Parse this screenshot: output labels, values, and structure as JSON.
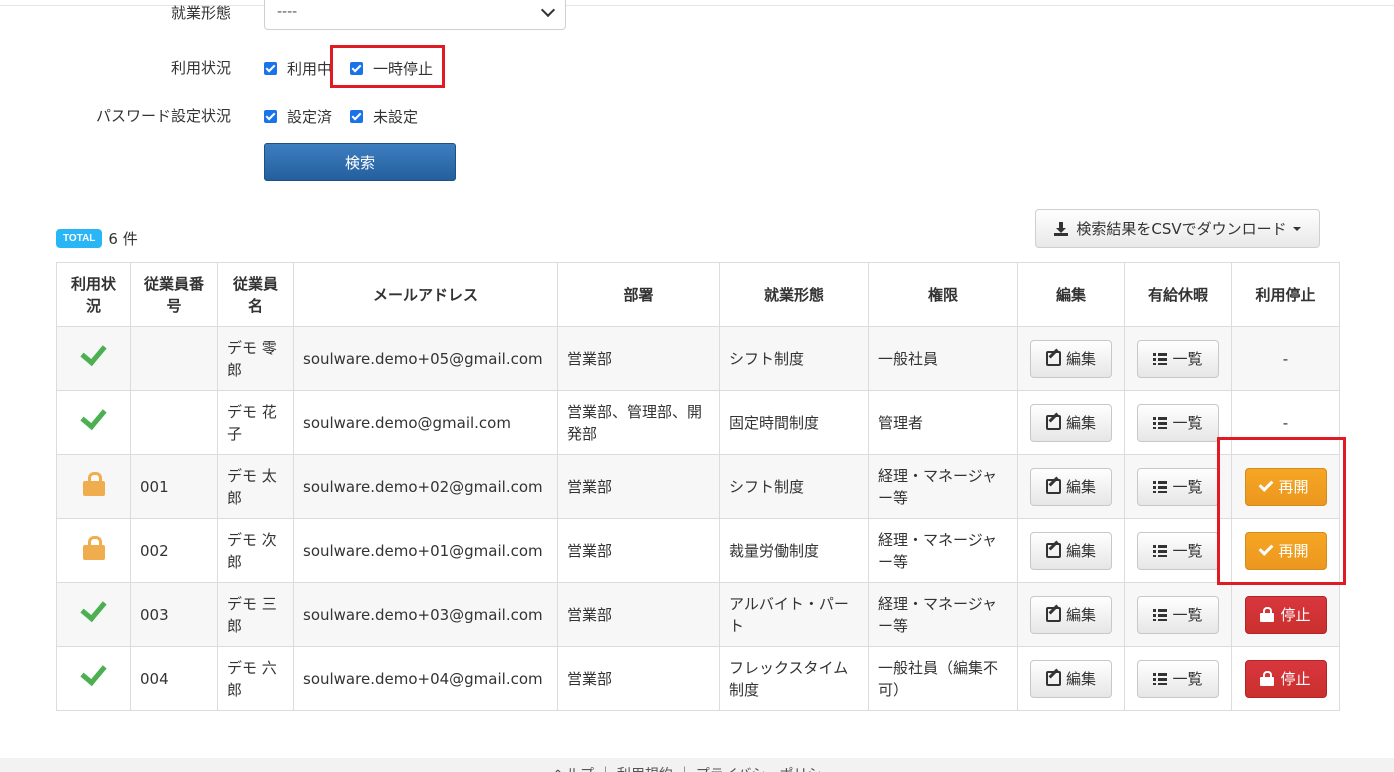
{
  "form": {
    "employment_type": {
      "label": "就業形態",
      "value": "----"
    },
    "usage_status": {
      "label": "利用状況",
      "options": [
        {
          "label": "利用中"
        },
        {
          "label": "一時停止"
        }
      ]
    },
    "password_status": {
      "label": "パスワード設定状況",
      "options": [
        {
          "label": "設定済"
        },
        {
          "label": "未設定"
        }
      ]
    },
    "search_label": "検索"
  },
  "total": {
    "badge": "TOTAL",
    "count": "6 件"
  },
  "csv_button_label": "検索結果をCSVでダウンロード",
  "table": {
    "headers": [
      "利用状況",
      "従業員番号",
      "従業員名",
      "メールアドレス",
      "部署",
      "就業形態",
      "権限",
      "編集",
      "有給休暇",
      "利用停止"
    ],
    "edit_label": "編集",
    "list_label": "一覧",
    "resume_label": "再開",
    "stop_label": "停止",
    "rows": [
      {
        "status": "active",
        "number": "",
        "name": "デモ 零郎",
        "email": "soulware.demo+05@gmail.com",
        "dept": "営業部",
        "employment": "シフト制度",
        "role": "一般社員",
        "action": "-"
      },
      {
        "status": "active",
        "number": "",
        "name": "デモ 花子",
        "email": "soulware.demo@gmail.com",
        "dept": "営業部、管理部、開発部",
        "employment": "固定時間制度",
        "role": "管理者",
        "action": "-"
      },
      {
        "status": "paused",
        "number": "001",
        "name": "デモ 太郎",
        "email": "soulware.demo+02@gmail.com",
        "dept": "営業部",
        "employment": "シフト制度",
        "role": "経理・マネージャー等",
        "action": "resume"
      },
      {
        "status": "paused",
        "number": "002",
        "name": "デモ 次郎",
        "email": "soulware.demo+01@gmail.com",
        "dept": "営業部",
        "employment": "裁量労働制度",
        "role": "経理・マネージャー等",
        "action": "resume"
      },
      {
        "status": "active",
        "number": "003",
        "name": "デモ 三郎",
        "email": "soulware.demo+03@gmail.com",
        "dept": "営業部",
        "employment": "アルバイト・パート",
        "role": "経理・マネージャー等",
        "action": "stop"
      },
      {
        "status": "active",
        "number": "004",
        "name": "デモ 六郎",
        "email": "soulware.demo+04@gmail.com",
        "dept": "営業部",
        "employment": "フレックスタイム制度",
        "role": "一般社員（編集不可）",
        "action": "stop"
      }
    ]
  },
  "footer": {
    "text": "ヘルプ ｜ 利用規約 ｜ プライバシーポリシー"
  },
  "colors": {
    "accent": "#245f9d",
    "active": "#4caf50",
    "paused": "#f0ad4e",
    "stop": "#c9302c",
    "highlight": "#e01b24"
  },
  "icons": {
    "active": "check-icon",
    "paused": "lock-icon",
    "edit": "edit-icon",
    "list": "list-icon",
    "download": "download-icon"
  }
}
